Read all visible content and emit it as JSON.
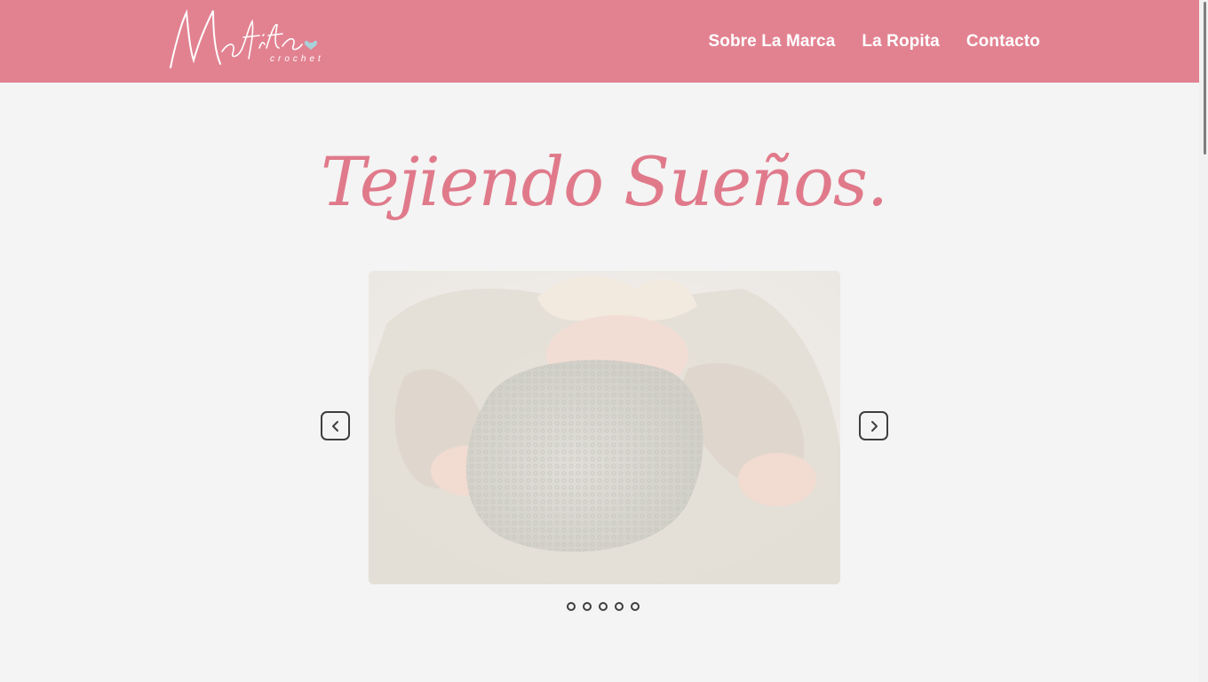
{
  "brand": {
    "logo_text": "Mafita",
    "logo_subtext": "crochet",
    "header_color": "#e28291",
    "accent_color": "#e07a8b"
  },
  "nav": {
    "items": [
      {
        "label": "Sobre La Marca"
      },
      {
        "label": "La Ropita"
      },
      {
        "label": "Contacto"
      }
    ]
  },
  "hero": {
    "title": "Tejiendo Sueños."
  },
  "carousel": {
    "prev_icon": "chevron-left-icon",
    "next_icon": "chevron-right-icon",
    "slide_count": 5,
    "active_index": 0
  }
}
